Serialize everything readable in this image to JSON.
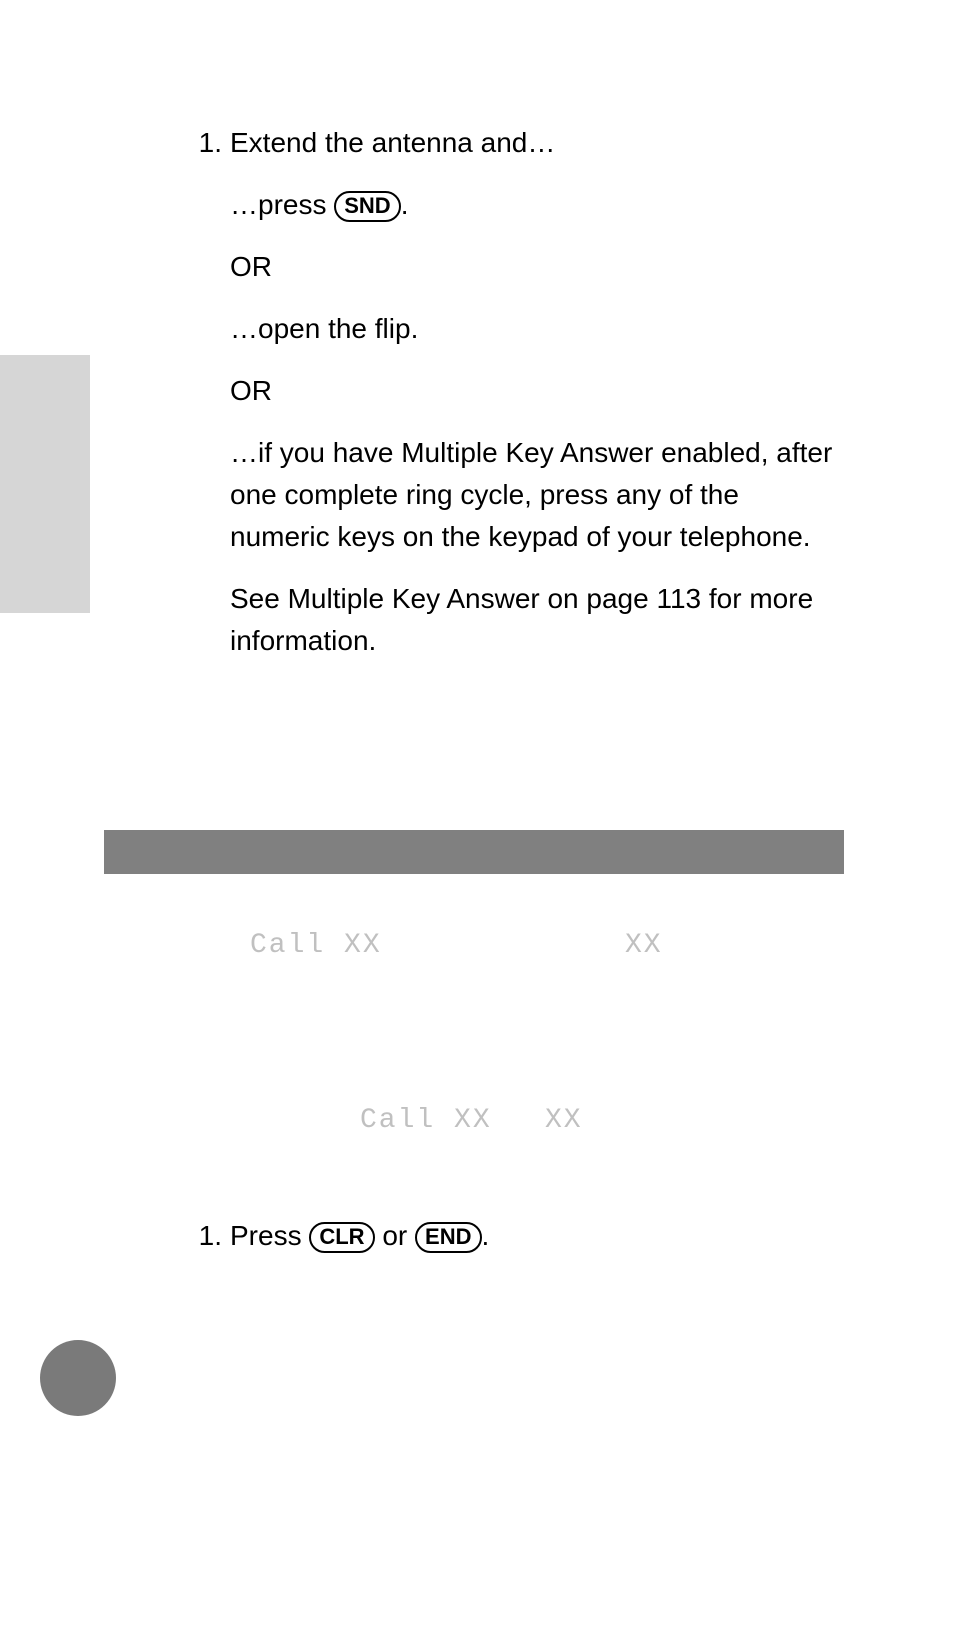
{
  "step1": {
    "num": "1.",
    "line1": "Extend the antenna and…",
    "line2a": "…press ",
    "line2b": ".",
    "or1": "OR",
    "line3": "…open the flip.",
    "or2": "OR",
    "line4": "…if you have Multiple Key Answer enabled, after one complete ring cycle, press any of the numeric keys on the keypad of your telephone.",
    "line5": "See Multiple Key Answer on page 113 for more information."
  },
  "keys": {
    "snd": "SND",
    "clr": "CLR",
    "end": "END"
  },
  "display": {
    "callxx1": "Call XX",
    "xx1": "XX",
    "callxx2": "Call XX",
    "xx2": "XX"
  },
  "step2": {
    "num": "1.",
    "textA": "Press ",
    "textB": " or ",
    "textC": "."
  }
}
